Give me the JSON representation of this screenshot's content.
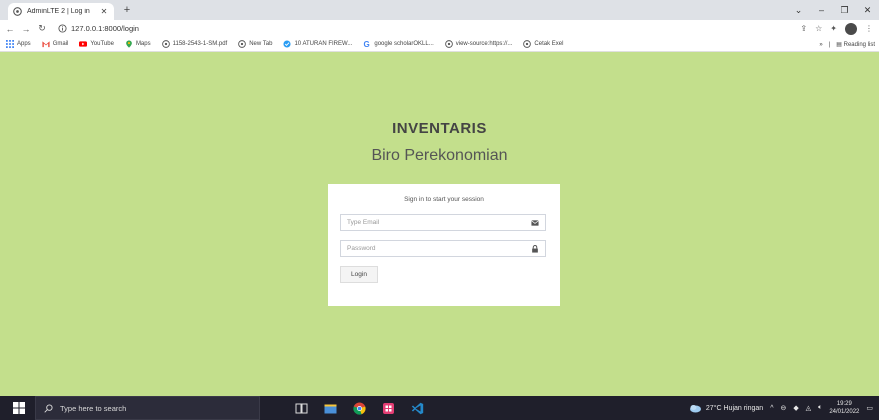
{
  "browser": {
    "tab_title": "AdminLTE 2 | Log in",
    "url": "127.0.0.1:8000/login",
    "bookmarks": [
      {
        "label": "Apps",
        "icon": "apps-grid-icon"
      },
      {
        "label": "Gmail",
        "icon": "gmail-icon"
      },
      {
        "label": "YouTube",
        "icon": "youtube-icon"
      },
      {
        "label": "Maps",
        "icon": "maps-icon"
      },
      {
        "label": "1158-2543-1-SM.pdf",
        "icon": "globe-icon"
      },
      {
        "label": "New Tab",
        "icon": "globe-icon"
      },
      {
        "label": "10 ATURAN FIREW...",
        "icon": "firewall-icon"
      },
      {
        "label": "google scholarOKLL...",
        "icon": "google-icon"
      },
      {
        "label": "view-source:https://...",
        "icon": "globe-icon"
      },
      {
        "label": "Cetak Exel",
        "icon": "globe-icon"
      }
    ],
    "more_bookmarks": "»",
    "reading_list": "Reading list"
  },
  "page": {
    "brand_title": "INVENTARIS",
    "brand_subtitle": "Biro Perekonomian",
    "login_message": "Sign in to start your session",
    "email_placeholder": "Type Email",
    "password_placeholder": "Password",
    "login_button": "Login"
  },
  "taskbar": {
    "search_placeholder": "Type here to search",
    "weather": "27°C  Hujan ringan",
    "time": "19:29",
    "date": "24/01/2022"
  },
  "colors": {
    "page_background": "#c3df8c",
    "taskbar": "#1f1f2b"
  }
}
